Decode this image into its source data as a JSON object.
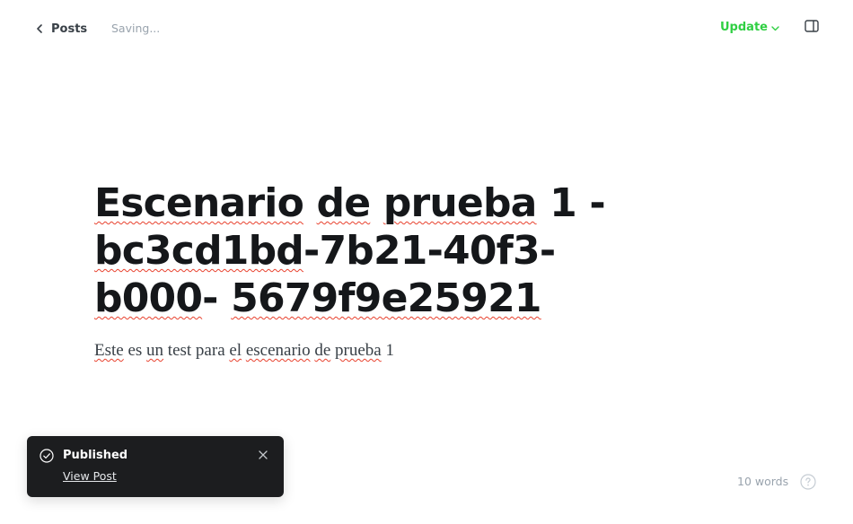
{
  "header": {
    "back_label": "Posts",
    "status_text": "Saving...",
    "update_label": "Update"
  },
  "editor": {
    "title_words": [
      "Escenario",
      " ",
      "de",
      " ",
      "prueba",
      " 1 -",
      " ",
      "bc3cd1bd",
      "-7b21-40f3-",
      "b000",
      "-",
      " ",
      "5679f9e25921"
    ],
    "body_words": [
      "Este",
      " es ",
      "un",
      " test para ",
      "el",
      " ",
      "escenario",
      " ",
      "de",
      " ",
      "prueba",
      " 1"
    ]
  },
  "toast": {
    "title": "Published",
    "link_label": "View Post"
  },
  "footer": {
    "word_count": "10 words"
  },
  "colors": {
    "accent_green": "#30cf43",
    "toast_bg": "#1c1d1f",
    "spellcheck_underline": "#e8412e"
  },
  "icons": [
    "chevron-left-icon",
    "chevron-down-icon",
    "sidebar-icon",
    "check-circle-icon",
    "close-icon",
    "help-icon"
  ]
}
